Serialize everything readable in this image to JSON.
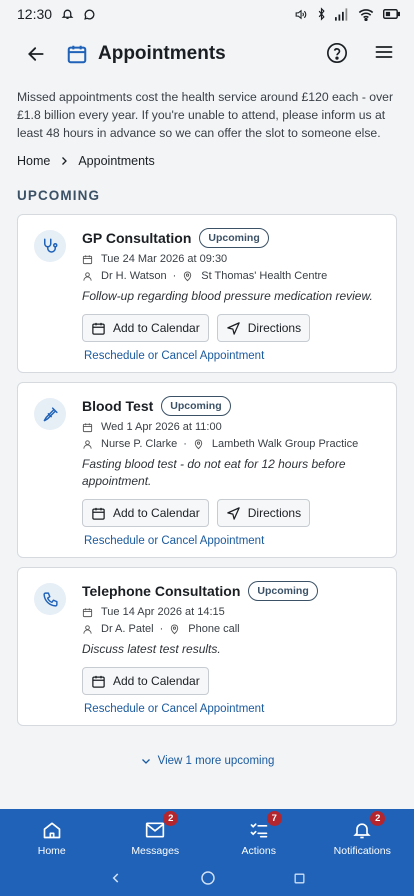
{
  "status_bar": {
    "time": "12:30"
  },
  "header": {
    "title": "Appointments"
  },
  "notice": "Missed appointments cost the health service around £120 each - over £1.8 billion every year. If you're unable to attend, please inform us at least 48 hours in advance so we can offer the slot to someone else.",
  "breadcrumb": {
    "home": "Home",
    "current": "Appointments"
  },
  "section_title": "UPCOMING",
  "appointments": [
    {
      "icon": "stethoscope-icon",
      "title": "GP Consultation",
      "badge": "Upcoming",
      "datetime": "Tue 24 Mar 2026 at 09:30",
      "person": "Dr H. Watson",
      "location": "St Thomas' Health Centre",
      "description": "Follow-up regarding blood pressure medication review.",
      "calendar_label": "Add to Calendar",
      "directions_label": "Directions",
      "manage_label": "Reschedule or Cancel Appointment"
    },
    {
      "icon": "syringe-icon",
      "title": "Blood Test",
      "badge": "Upcoming",
      "datetime": "Wed 1 Apr 2026 at 11:00",
      "person": "Nurse P. Clarke",
      "location": "Lambeth Walk Group Practice",
      "description": "Fasting blood test - do not eat for 12 hours before appointment.",
      "calendar_label": "Add to Calendar",
      "directions_label": "Directions",
      "manage_label": "Reschedule or Cancel Appointment"
    },
    {
      "icon": "phone-icon",
      "title": "Telephone Consultation",
      "badge": "Upcoming",
      "datetime": "Tue 14 Apr 2026 at 14:15",
      "person": "Dr A. Patel",
      "location": "Phone call",
      "description": "Discuss latest test results.",
      "calendar_label": "Add to Calendar",
      "manage_label": "Reschedule or Cancel Appointment"
    }
  ],
  "view_more": "View 1 more upcoming",
  "bottom_nav": [
    {
      "label": "Home",
      "icon": "home-icon"
    },
    {
      "label": "Messages",
      "icon": "mail-icon",
      "badge": "2"
    },
    {
      "label": "Actions",
      "icon": "checklist-icon",
      "badge": "7"
    },
    {
      "label": "Notifications",
      "icon": "bell-icon",
      "badge": "2"
    }
  ],
  "colors": {
    "accent": "#1f62b8",
    "link": "#1a5a9e",
    "badge": "#b3262e"
  }
}
